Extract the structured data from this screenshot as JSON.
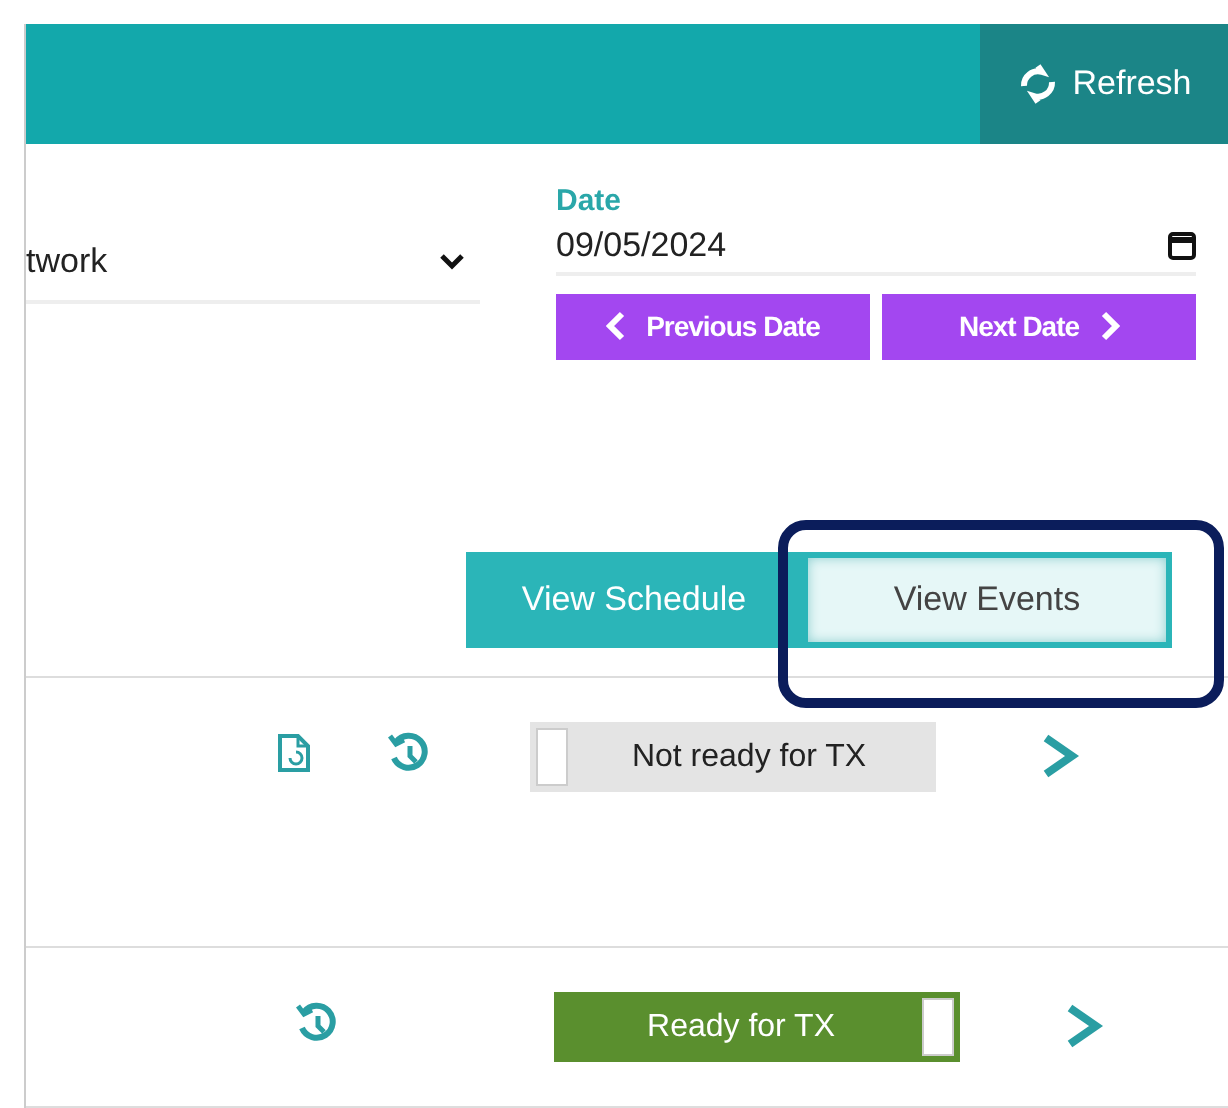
{
  "header": {
    "refresh_label": "Refresh"
  },
  "filters": {
    "network": {
      "value": "twork"
    },
    "date": {
      "label": "Date",
      "value": "09/05/2024"
    },
    "date_buttons": [
      {
        "kind": "previous",
        "label": "Previous Date"
      },
      {
        "kind": "next",
        "label": "Next Date"
      }
    ]
  },
  "view_toggle": [
    {
      "label": "View Schedule",
      "selected": false,
      "highlighted": false
    },
    {
      "label": "View Events",
      "selected": true,
      "highlighted": true
    }
  ],
  "rows": [
    {
      "document_icon": true,
      "status": {
        "label": "Not ready for TX",
        "ready": false
      }
    },
    {
      "document_icon": false,
      "status": {
        "label": "Ready for TX",
        "ready": true
      }
    }
  ]
}
